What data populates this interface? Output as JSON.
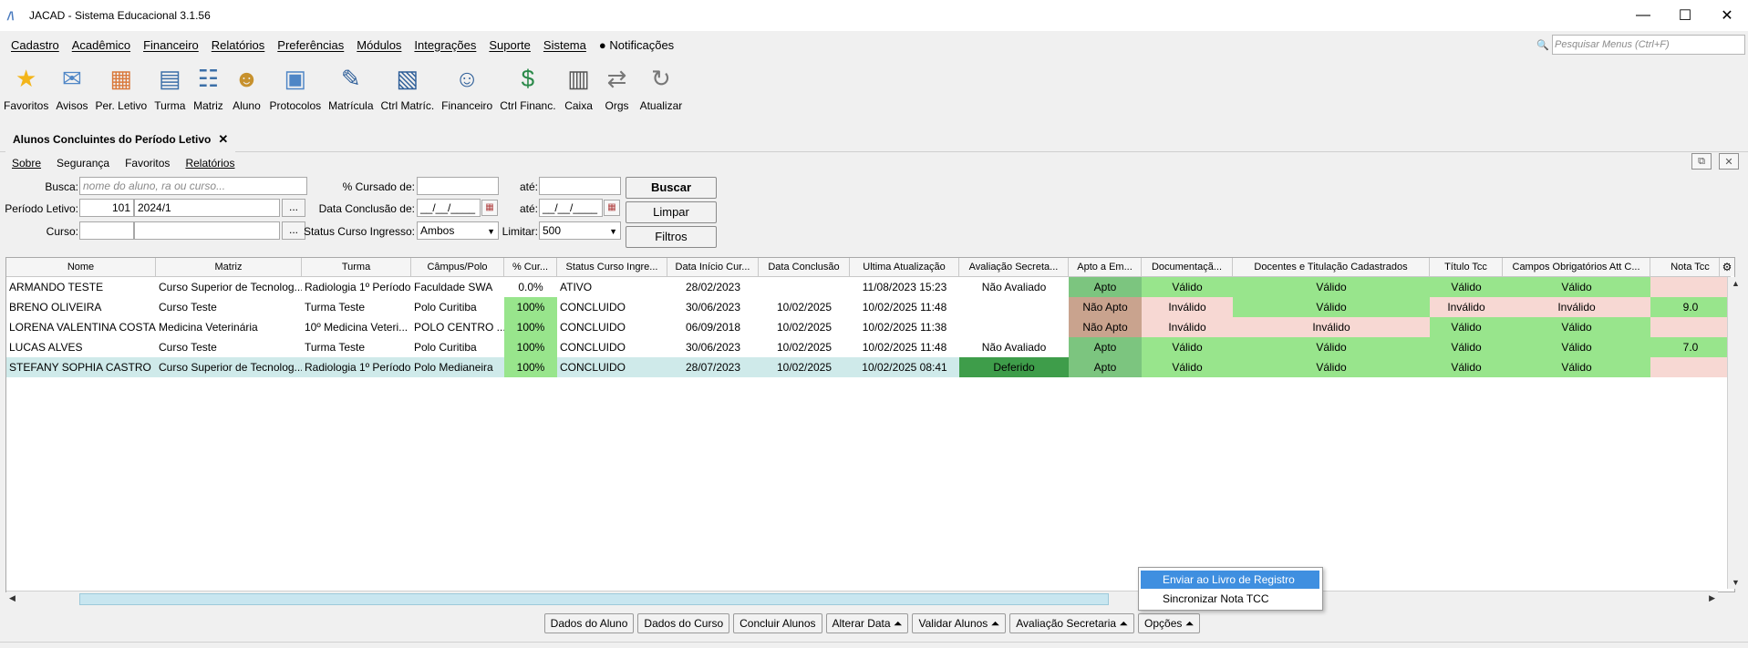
{
  "window": {
    "title": "JACAD - Sistema Educacional 3.1.56",
    "minimize": "—",
    "maximize": "☐",
    "close": "✕"
  },
  "menu": {
    "items": [
      "Cadastro",
      "Acadêmico",
      "Financeiro",
      "Relatórios",
      "Preferências",
      "Módulos",
      "Integrações",
      "Suporte",
      "Sistema"
    ],
    "notifications": "Notificações",
    "search_placeholder": "Pesquisar Menus (Ctrl+F)"
  },
  "toolbar": [
    {
      "label": "Favoritos",
      "icon": "star-icon"
    },
    {
      "label": "Avisos",
      "icon": "envelope-icon"
    },
    {
      "label": "Per. Letivo",
      "icon": "calendar-icon"
    },
    {
      "label": "Turma",
      "icon": "group-icon"
    },
    {
      "label": "Matriz",
      "icon": "matrix-icon"
    },
    {
      "label": "Aluno",
      "icon": "student-icon"
    },
    {
      "label": "Protocolos",
      "icon": "protocol-icon"
    },
    {
      "label": "Matrícula",
      "icon": "enrollment-icon"
    },
    {
      "label": "Ctrl Matríc.",
      "icon": "enrollment-control-icon"
    },
    {
      "label": "Financeiro",
      "icon": "finance-icon"
    },
    {
      "label": "Ctrl Financ.",
      "icon": "finance-control-icon"
    },
    {
      "label": "Caixa",
      "icon": "cash-register-icon"
    },
    {
      "label": "Orgs",
      "icon": "swap-icon"
    },
    {
      "label": "Atualizar",
      "icon": "refresh-icon"
    }
  ],
  "tab": {
    "label": "Alunos Concluintes do Período Letivo",
    "close": "✕"
  },
  "submenu": [
    "Sobre",
    "Segurança",
    "Favoritos",
    "Relatórios"
  ],
  "form": {
    "busca_label": "Busca:",
    "busca_placeholder": "nome do aluno, ra ou curso...",
    "periodo_label": "Período Letivo:",
    "periodo_code": "101",
    "periodo_value": "2024/1",
    "curso_label": "Curso:",
    "cursado_label": "% Cursado de:",
    "ate1_label": "até:",
    "conclusao_label": "Data Conclusão de:",
    "date_placeholder": "__/__/____",
    "ate2_label": "até:",
    "status_label": "Status Curso Ingresso:",
    "status_value": "Ambos",
    "limitar_label": "Limitar:",
    "limitar_value": "500",
    "ellipsis": "...",
    "buscar": "Buscar",
    "limpar": "Limpar",
    "filtros": "Filtros"
  },
  "table": {
    "columns": [
      "Nome",
      "Matriz",
      "Turma",
      "Câmpus/Polo",
      "% Cur...",
      "Status Curso Ingre...",
      "Data Início Cur...",
      "Data Conclusão",
      "Ultima Atualização",
      "Avaliação Secreta...",
      "Apto a Em...",
      "Documentaçã...",
      "Docentes e Titulação Cadastrados",
      "Título Tcc",
      "Campos Obrigatórios Att C...",
      "Nota Tcc"
    ],
    "rows": [
      [
        "ARMANDO TESTE",
        "Curso Superior de Tecnolog...",
        "Radiologia 1º Período",
        "Faculdade SWA",
        "0.0%",
        "ATIVO",
        "28/02/2023",
        "",
        "11/08/2023 15:23",
        "Não Avaliado",
        "Apto",
        "Válido",
        "Válido",
        "Válido",
        "Válido",
        ""
      ],
      [
        "BRENO OLIVEIRA",
        "Curso Teste",
        "Turma Teste",
        "Polo Curitiba",
        "100%",
        "CONCLUIDO",
        "30/06/2023",
        "10/02/2025",
        "10/02/2025 11:48",
        "",
        "Não Apto",
        "Inválido",
        "Válido",
        "Inválido",
        "Inválido",
        "9.0"
      ],
      [
        "LORENA VALENTINA COSTA",
        "Medicina Veterinária",
        "10º Medicina Veteri...",
        " POLO CENTRO ...",
        "100%",
        "CONCLUIDO",
        "06/09/2018",
        "10/02/2025",
        "10/02/2025 11:38",
        "",
        "Não Apto",
        "Inválido",
        "Inválido",
        "Válido",
        "Válido",
        ""
      ],
      [
        "LUCAS ALVES",
        "Curso Teste",
        "Turma Teste",
        "Polo Curitiba",
        "100%",
        "CONCLUIDO",
        "30/06/2023",
        "10/02/2025",
        "10/02/2025 11:48",
        "Não Avaliado",
        "Apto",
        "Válido",
        "Válido",
        "Válido",
        "Válido",
        "7.0"
      ],
      [
        "STEFANY SOPHIA CASTRO",
        "Curso Superior de Tecnolog...",
        "Radiologia 1º Período",
        "Polo Medianeira",
        "100%",
        "CONCLUIDO",
        "28/07/2023",
        "10/02/2025",
        "10/02/2025 08:41",
        "Deferido",
        "Apto",
        "Válido",
        "Válido",
        "Válido",
        "Válido",
        ""
      ]
    ]
  },
  "bottom_buttons": [
    "Dados do Aluno",
    "Dados do Curso",
    "Concluir Alunos",
    "Alterar Data ⏶",
    "Validar Alunos ⏶",
    "Avaliação Secretaria ⏶",
    "Opções ⏶"
  ],
  "popup": [
    "Enviar ao Livro de Registro",
    "Sincronizar Nota TCC"
  ],
  "colors": {
    "valid": "#98e58c",
    "invalid": "#f7d8d3",
    "apto": "#7cc57f",
    "nao_apto": "#c9a38e",
    "deferido": "#3e9d4a",
    "selected_row": "#cfeaea",
    "popup_highlight": "#3f8fe0"
  }
}
